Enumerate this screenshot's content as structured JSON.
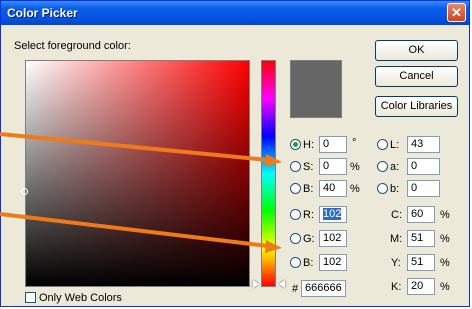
{
  "window": {
    "title": "Color Picker",
    "close_glyph": "✕"
  },
  "picker": {
    "select_label": "Select foreground color:",
    "current_color": "#666666"
  },
  "buttons": {
    "ok": "OK",
    "cancel": "Cancel",
    "libraries": "Color Libraries"
  },
  "hsb": {
    "h": {
      "label": "H:",
      "value": "0",
      "unit": "°"
    },
    "s": {
      "label": "S:",
      "value": "0",
      "unit": "%"
    },
    "b": {
      "label": "B:",
      "value": "40",
      "unit": "%"
    }
  },
  "lab": {
    "l": {
      "label": "L:",
      "value": "43"
    },
    "a": {
      "label": "a:",
      "value": "0"
    },
    "b": {
      "label": "b:",
      "value": "0"
    }
  },
  "rgb": {
    "r": {
      "label": "R:",
      "value": "102"
    },
    "g": {
      "label": "G:",
      "value": "102"
    },
    "b": {
      "label": "B:",
      "value": "102"
    }
  },
  "cmyk": {
    "c": {
      "label": "C:",
      "value": "60",
      "unit": "%"
    },
    "m": {
      "label": "M:",
      "value": "51",
      "unit": "%"
    },
    "y": {
      "label": "Y:",
      "value": "51",
      "unit": "%"
    },
    "k": {
      "label": "K:",
      "value": "20",
      "unit": "%"
    }
  },
  "hex": {
    "label": "#",
    "value": "666666"
  },
  "web_colors": {
    "label": "Only Web Colors",
    "checked": false
  },
  "annotation": {
    "arrow_color": "#f07a1a"
  }
}
